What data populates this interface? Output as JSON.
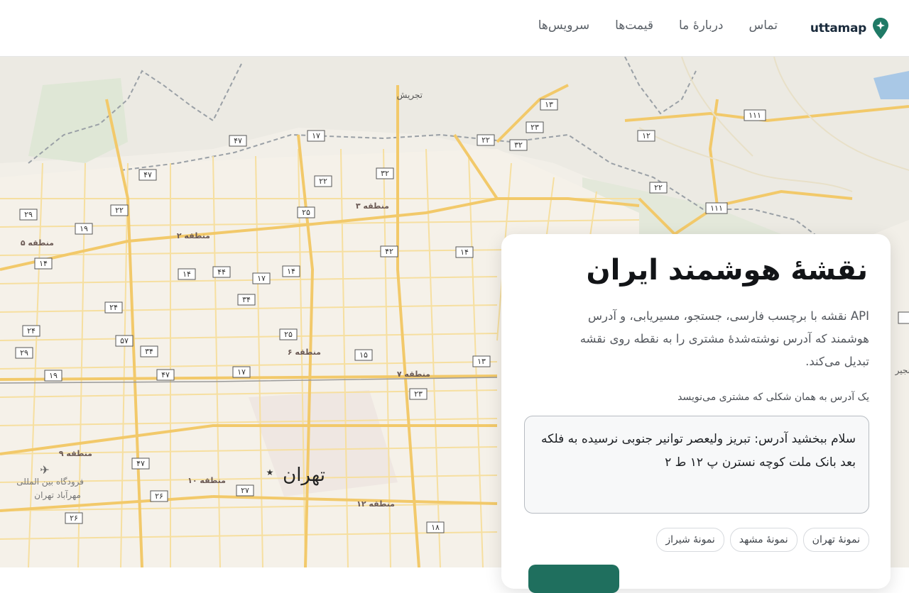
{
  "header": {
    "logo_text": "uttamap",
    "brand_color": "#1f7a66",
    "nav": [
      "سرویس‌ها",
      "قیمت‌ها",
      "دربارهٔ ما",
      "تماس"
    ]
  },
  "map": {
    "city_label": "تهران",
    "airport_label_line1": "فرودگاه بین المللی",
    "airport_label_line2": "مهرآباد تهران",
    "tajrish_label": "تجریش",
    "edge_label": "نجیر",
    "districts": [
      "منطقه ۳",
      "منطقه ۲",
      "منطقه ۵",
      "منطقه ۶",
      "منطقه ۷",
      "منطقه ۹",
      "منطقه ۱۰",
      "منطقه ۱۲"
    ],
    "shields": [
      "۱۳",
      "۲۳",
      "۱۱۱",
      "۱۲",
      "۱۷",
      "۲۲",
      "۳۲",
      "۴۷",
      "۳۲",
      "۲۲",
      "۲۲",
      "۲۹",
      "۲۲",
      "۱۹",
      "۲۵",
      "۴۲",
      "۱۴",
      "۱۴",
      "۱۴",
      "۴۴",
      "۱۷",
      "۱۴",
      "۳۴",
      "۲۴",
      "۲۴",
      "۵۷",
      "۳۴",
      "۲۵",
      "۱۵",
      "۲۹",
      "۱۹",
      "۴۷",
      "۱۷",
      "۲۳",
      "۱۳",
      "۴۷",
      "۲۷",
      "۲۶",
      "۲۶",
      "۱۸",
      "۱۱۱",
      "۴۷",
      "۲۴",
      "۱۴"
    ]
  },
  "panel": {
    "title": "نقشهٔ هوشمند ایران",
    "description": "API نقشه با برچسب فارسی، جستجو، مسیریابی، و آدرس هوشمند که آدرس نوشته‌شدهٔ مشتری را به نقطه روی نقشه تبدیل می‌کند.",
    "input_label": "یک آدرس به همان شکلی که مشتری می‌نویسد",
    "address_value": "سلام ببخشید آدرس: تبریز ولیعصر توانیر جنوبی نرسیده به فلکه بعد بانک ملت کوچه نسترن پ ۱۲ ط ۲",
    "samples": [
      "نمونهٔ تهران",
      "نمونهٔ مشهد",
      "نمونهٔ شیراز"
    ]
  }
}
